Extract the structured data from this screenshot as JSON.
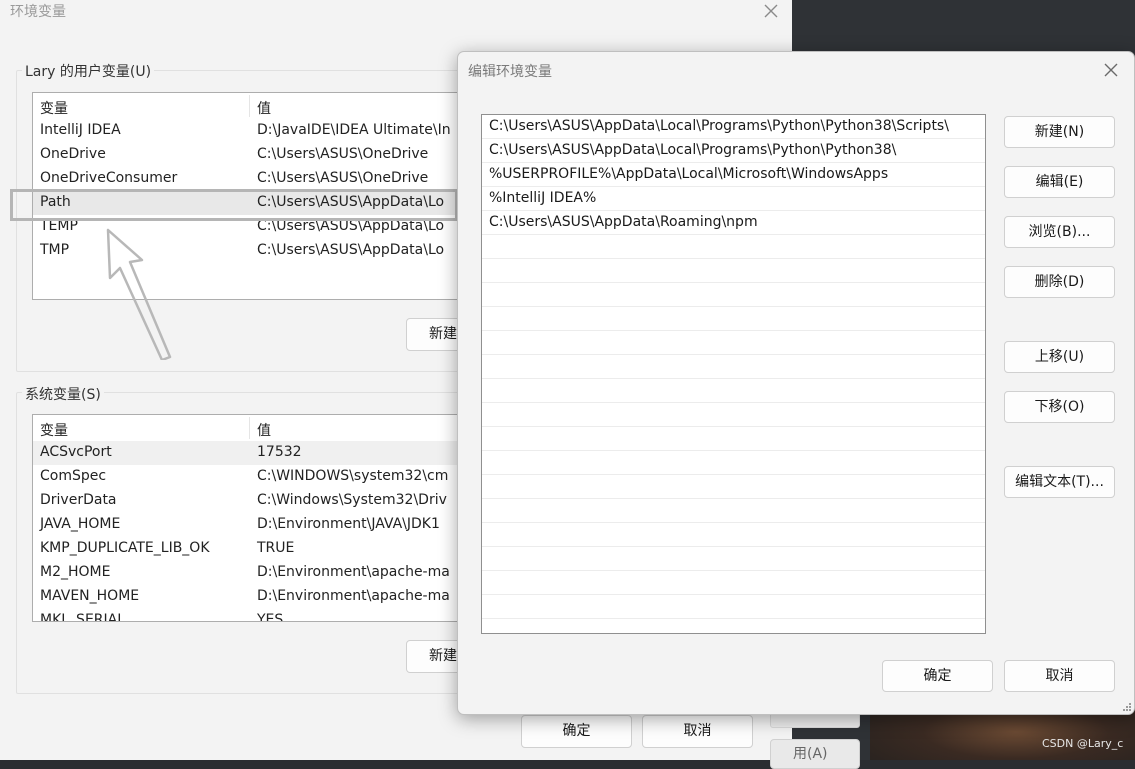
{
  "back_window": {
    "title": "环境变量",
    "user_vars": {
      "legend": "Lary 的用户变量(U)",
      "col_name": "变量",
      "col_value": "值",
      "rows": [
        {
          "name": "IntelliJ IDEA",
          "value": "D:\\JavaIDE\\IDEA Ultimate\\In"
        },
        {
          "name": "OneDrive",
          "value": "C:\\Users\\ASUS\\OneDrive"
        },
        {
          "name": "OneDriveConsumer",
          "value": "C:\\Users\\ASUS\\OneDrive"
        },
        {
          "name": "Path",
          "value": "C:\\Users\\ASUS\\AppData\\Lo"
        },
        {
          "name": "TEMP",
          "value": "C:\\Users\\ASUS\\AppData\\Lo"
        },
        {
          "name": "TMP",
          "value": "C:\\Users\\ASUS\\AppData\\Lo"
        }
      ],
      "new_button": "新建"
    },
    "system_vars": {
      "legend": "系统变量(S)",
      "col_name": "变量",
      "col_value": "值",
      "rows": [
        {
          "name": "ACSvcPort",
          "value": "17532"
        },
        {
          "name": "ComSpec",
          "value": "C:\\WINDOWS\\system32\\cm"
        },
        {
          "name": "DriverData",
          "value": "C:\\Windows\\System32\\Driv"
        },
        {
          "name": "JAVA_HOME",
          "value": "D:\\Environment\\JAVA\\JDK1"
        },
        {
          "name": "KMP_DUPLICATE_LIB_OK",
          "value": "TRUE"
        },
        {
          "name": "M2_HOME",
          "value": "D:\\Environment\\apache-ma"
        },
        {
          "name": "MAVEN_HOME",
          "value": "D:\\Environment\\apache-ma"
        },
        {
          "name": "MKL_SERIAL",
          "value": "YES"
        }
      ],
      "new_button": "新建"
    },
    "ok_button": "确定",
    "cancel_button": "取消",
    "apply_button_partial": "用(A)"
  },
  "edit_dialog": {
    "title": "编辑环境变量",
    "entries": [
      "C:\\Users\\ASUS\\AppData\\Local\\Programs\\Python\\Python38\\Scripts\\",
      "C:\\Users\\ASUS\\AppData\\Local\\Programs\\Python\\Python38\\",
      "%USERPROFILE%\\AppData\\Local\\Microsoft\\WindowsApps",
      "%IntelliJ IDEA%",
      "C:\\Users\\ASUS\\AppData\\Roaming\\npm"
    ],
    "buttons": {
      "new": "新建(N)",
      "edit": "编辑(E)",
      "browse": "浏览(B)...",
      "delete": "删除(D)",
      "move_up": "上移(U)",
      "move_down": "下移(O)",
      "edit_text": "编辑文本(T)..."
    },
    "ok_button": "确定",
    "cancel_button": "取消"
  },
  "watermark": "CSDN @Lary_c"
}
